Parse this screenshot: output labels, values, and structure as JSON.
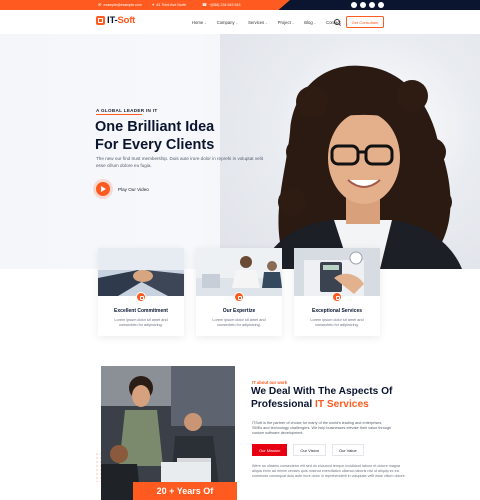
{
  "topbar": {
    "email": "example@example.com",
    "address": "44 Third Ave North",
    "phone": "+(088) 234 543 543",
    "email_icon": "mail-icon",
    "address_icon": "map-pin-icon",
    "phone_icon": "phone-icon",
    "socials": [
      "facebook-icon",
      "twitter-icon",
      "instagram-icon",
      "linkedin-icon"
    ]
  },
  "header": {
    "logo_main": "IT-",
    "logo_accent": "Soft",
    "nav": [
      {
        "label": "Home",
        "dropdown": true
      },
      {
        "label": "Company",
        "dropdown": true
      },
      {
        "label": "Services",
        "dropdown": true
      },
      {
        "label": "Project",
        "dropdown": true
      },
      {
        "label": "Blog",
        "dropdown": true
      },
      {
        "label": "Contact",
        "dropdown": false
      }
    ],
    "chevron": "⌄",
    "cta_label": "Get Consultant"
  },
  "hero": {
    "eyebrow": "A GLOBAL LEADER IN IT",
    "title_line1": "One Brilliant Idea",
    "title_line2": "For Every Clients",
    "description": "The new our find trust membership. Duis aute irure dolor in reprehi in voluptat velit esse cillum dolore eu fugia.",
    "play_label": "Play Our Video"
  },
  "cards": [
    {
      "title": "Excellent Commitment",
      "text": "Lorem ipsum dolor sit amet and consectetu for adipisicing."
    },
    {
      "title": "Our Expertize",
      "text": "Lorem ipsum dolor sit amet and consectetu for adipisicing."
    },
    {
      "title": "Exceptional Services",
      "text": "Lorem ipsum dolor sit amet and consectetu for adipisicing."
    }
  ],
  "about": {
    "eyebrow": "IT about our work",
    "title_line1": "We Deal With The Aspects Of",
    "title_plain": "Professional ",
    "title_accent": "IT Services",
    "description": "ITSoft is the partner of choice for many of the world's leading and enterprises, SMEs and technology challengers. We help businesses elevate their value through custom software development.",
    "tabs": [
      "Our Mission",
      "Our Vision",
      "Our Value"
    ],
    "active_tab": "Our Mission",
    "text2": "Were an ultrams consectetur elit sed do eiusmod tempor incididunt labore et dolore magna aliqua enim ad minim veniam quis nostrud exercitation ullamco laboris nisi ut aliquip ex ea commodo consequat duis aute irure dolor in reprehenderit in voluptate velit esse cillum dolore.",
    "experience_badge": "20 + Years Of"
  },
  "colors": {
    "accent": "#ff5a1f",
    "navy": "#0b1530",
    "tab_active": "#e60012"
  }
}
